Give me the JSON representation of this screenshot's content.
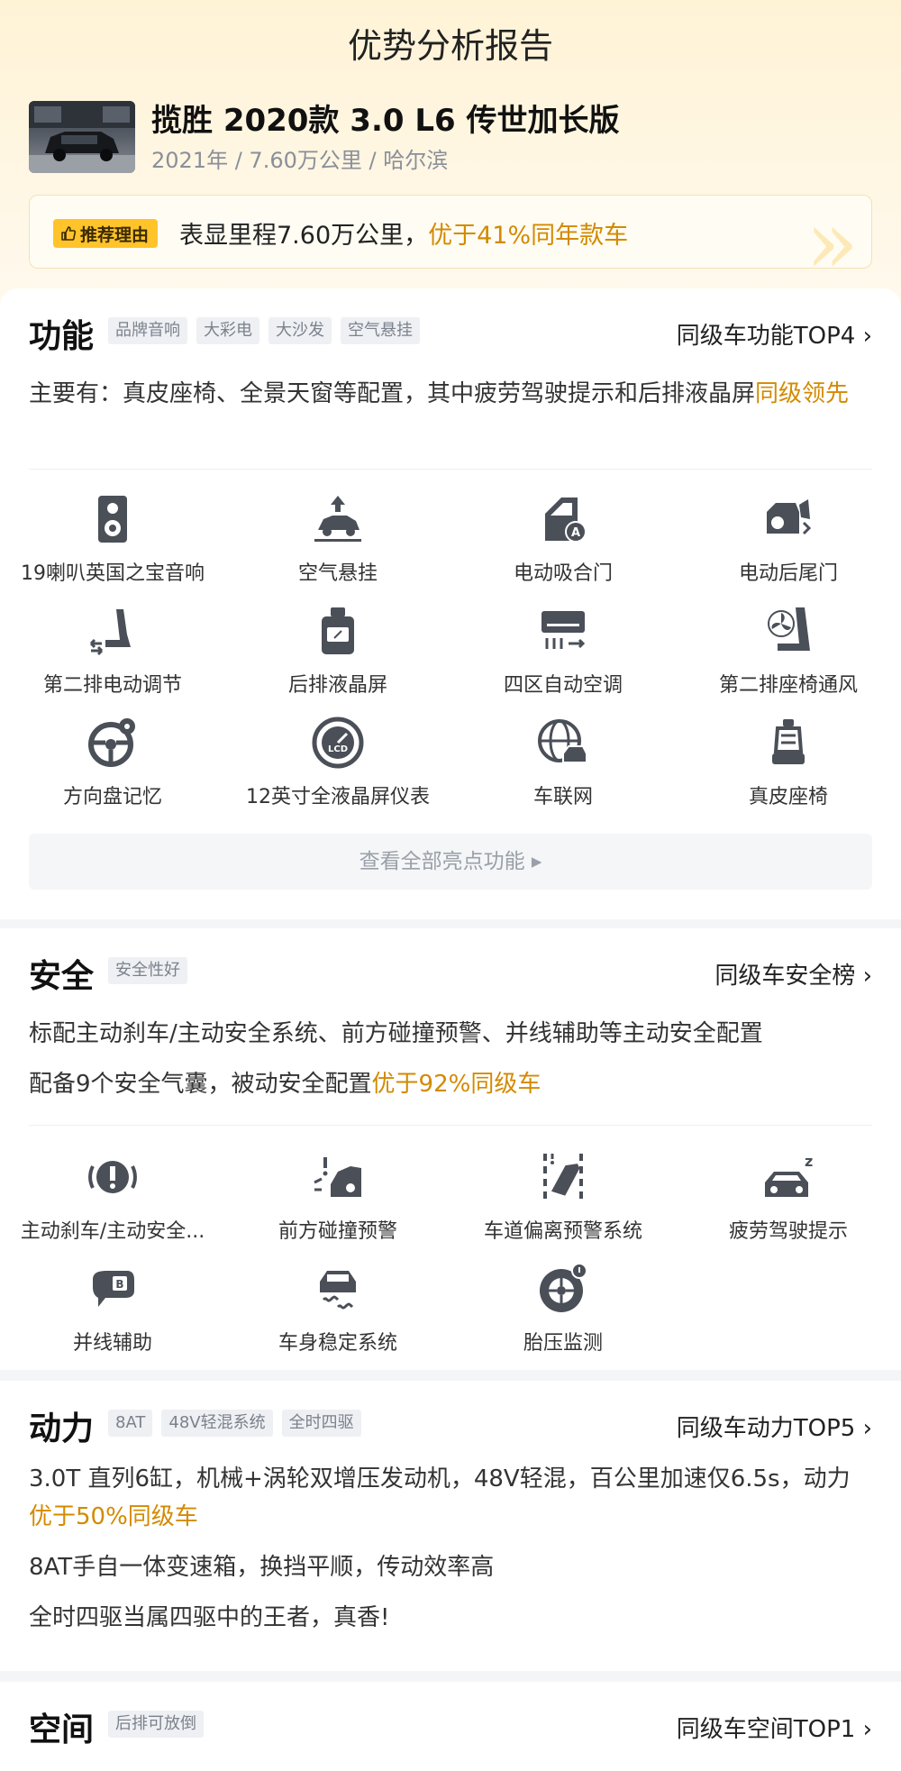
{
  "header": {
    "title": "优势分析报告"
  },
  "car": {
    "name": "揽胜 2020款 3.0 L6 传世加长版",
    "meta": "2021年 / 7.60万公里 / 哈尔滨"
  },
  "reason": {
    "badge": "推荐理由",
    "text_prefix": "表显里程7.60万公里，",
    "text_highlight": "优于41%同年款车"
  },
  "colors": {
    "highlight": "#d38a00",
    "badge_bg": "#ffc42a",
    "hero_bg": "#fff3d6"
  },
  "features": {
    "title": "功能",
    "tags": [
      "品牌音响",
      "大彩电",
      "大沙发",
      "空气悬挂"
    ],
    "rank_link": "同级车功能TOP4",
    "desc_prefix": "主要有：真皮座椅、全景天窗等配置，其中疲劳驾驶提示和后排液晶屏",
    "desc_highlight": "同级领先",
    "items": [
      {
        "label": "19喇叭英国之宝音响",
        "icon": "speaker-icon"
      },
      {
        "label": "空气悬挂",
        "icon": "air-suspension-icon"
      },
      {
        "label": "电动吸合门",
        "icon": "soft-close-door-icon"
      },
      {
        "label": "电动后尾门",
        "icon": "power-tailgate-icon"
      },
      {
        "label": "第二排电动调节",
        "icon": "seat-adjust-icon"
      },
      {
        "label": "后排液晶屏",
        "icon": "rear-screen-icon"
      },
      {
        "label": "四区自动空调",
        "icon": "climate-control-icon"
      },
      {
        "label": "第二排座椅通风",
        "icon": "seat-ventilation-icon"
      },
      {
        "label": "方向盘记忆",
        "icon": "steering-wheel-icon"
      },
      {
        "label": "12英寸全液晶屏仪表",
        "icon": "lcd-gauge-icon"
      },
      {
        "label": "车联网",
        "icon": "connected-car-icon"
      },
      {
        "label": "真皮座椅",
        "icon": "leather-seat-icon"
      }
    ],
    "view_all": "查看全部亮点功能 ▸"
  },
  "safety": {
    "title": "安全",
    "tags": [
      "安全性好"
    ],
    "rank_link": "同级车安全榜",
    "desc_line1": "标配主动刹车/主动安全系统、前方碰撞预警、并线辅助等主动安全配置",
    "desc_line2_prefix": "配备9个安全气囊，被动安全配置",
    "desc_line2_highlight": "优于92%同级车",
    "items": [
      {
        "label": "主动刹车/主动安全...",
        "icon": "auto-brake-icon"
      },
      {
        "label": "前方碰撞预警",
        "icon": "collision-warning-icon"
      },
      {
        "label": "车道偏离预警系统",
        "icon": "lane-departure-icon"
      },
      {
        "label": "疲劳驾驶提示",
        "icon": "fatigue-alert-icon"
      },
      {
        "label": "并线辅助",
        "icon": "blind-spot-icon"
      },
      {
        "label": "车身稳定系统",
        "icon": "stability-control-icon"
      },
      {
        "label": "胎压监测",
        "icon": "tire-pressure-icon"
      }
    ]
  },
  "power": {
    "title": "动力",
    "tags": [
      "8AT",
      "48V轻混系统",
      "全时四驱"
    ],
    "rank_link": "同级车动力TOP5",
    "desc_line1_prefix": "3.0T 直列6缸，机械+涡轮双增压发动机，48V轻混，百公里加速仅6.5s，动力",
    "desc_line1_highlight": "优于50%同级车",
    "desc_line2": "8AT手自一体变速箱，换挡平顺，传动效率高",
    "desc_line3": "全时四驱当属四驱中的王者，真香!"
  },
  "space": {
    "title": "空间",
    "tags": [
      "后排可放倒"
    ],
    "rank_link": "同级车空间TOP1"
  },
  "chevron": "›"
}
